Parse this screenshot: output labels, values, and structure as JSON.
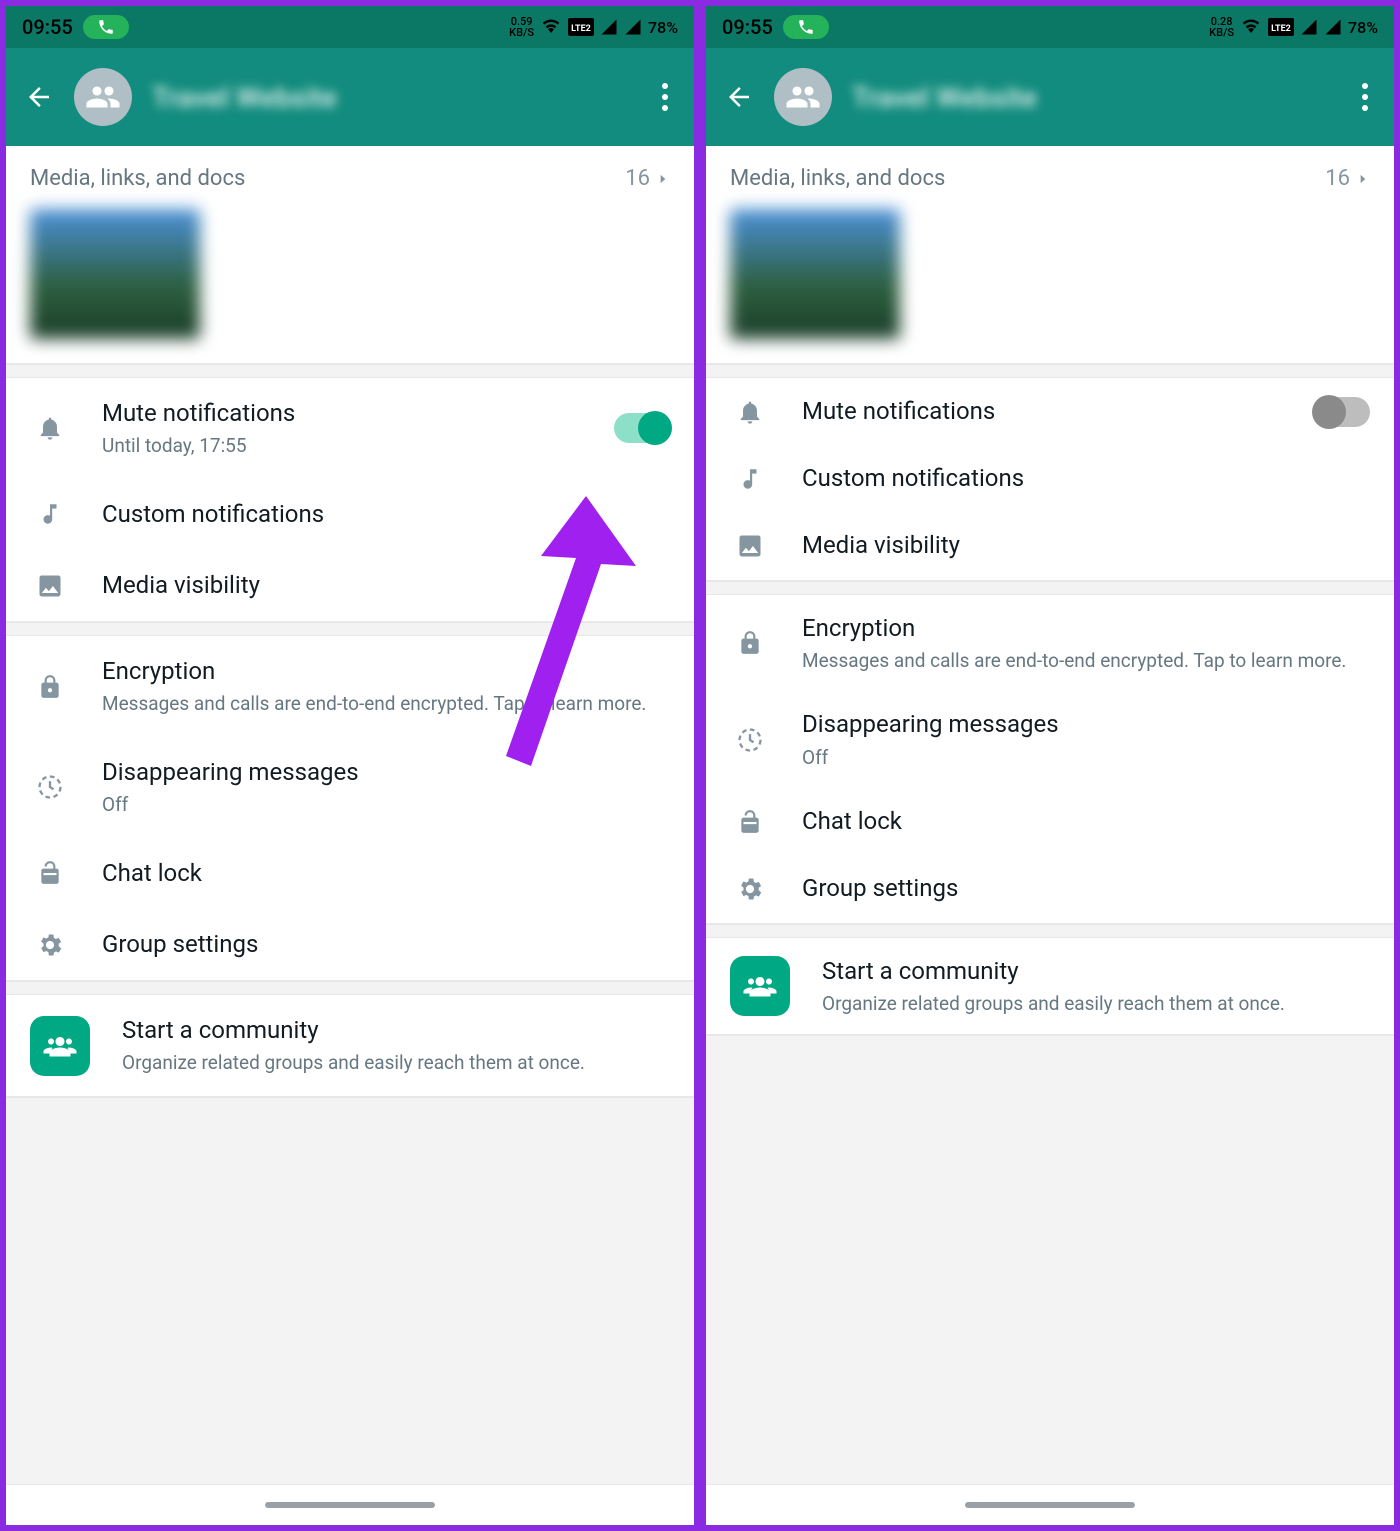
{
  "left": {
    "status": {
      "time": "09:55",
      "net_speed": "0.59",
      "net_unit": "KB/S",
      "battery": "78%"
    },
    "header": {
      "title": "Travel Website"
    },
    "media": {
      "label": "Media, links, and docs",
      "count": "16"
    },
    "mute": {
      "title": "Mute notifications",
      "sub": "Until today, 17:55"
    },
    "custom": {
      "title": "Custom notifications"
    },
    "visibility": {
      "title": "Media visibility"
    },
    "encryption": {
      "title": "Encryption",
      "sub": "Messages and calls are end-to-end encrypted. Tap to learn more."
    },
    "disappearing": {
      "title": "Disappearing messages",
      "sub": "Off"
    },
    "chatlock": {
      "title": "Chat lock"
    },
    "groupsettings": {
      "title": "Group settings"
    },
    "community": {
      "title": "Start a community",
      "sub": "Organize related groups and easily reach them at once."
    }
  },
  "right": {
    "status": {
      "time": "09:55",
      "net_speed": "0.28",
      "net_unit": "KB/S",
      "battery": "78%"
    },
    "header": {
      "title": "Travel Website"
    },
    "media": {
      "label": "Media, links, and docs",
      "count": "16"
    },
    "mute": {
      "title": "Mute notifications"
    },
    "custom": {
      "title": "Custom notifications"
    },
    "visibility": {
      "title": "Media visibility"
    },
    "encryption": {
      "title": "Encryption",
      "sub": "Messages and calls are end-to-end encrypted. Tap to learn more."
    },
    "disappearing": {
      "title": "Disappearing messages",
      "sub": "Off"
    },
    "chatlock": {
      "title": "Chat lock"
    },
    "groupsettings": {
      "title": "Group settings"
    },
    "community": {
      "title": "Start a community",
      "sub": "Organize related groups and easily reach them at once."
    }
  }
}
